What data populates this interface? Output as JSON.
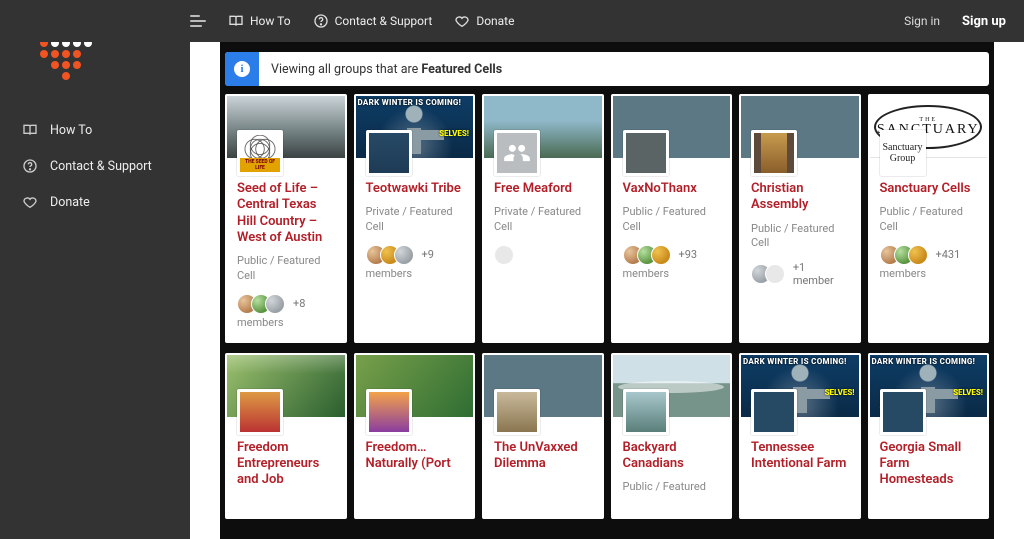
{
  "topnav": {
    "howto": "How To",
    "contact": "Contact & Support",
    "donate": "Donate",
    "signin": "Sign in",
    "signup": "Sign up"
  },
  "sidebar": {
    "howto": "How To",
    "contact": "Contact & Support",
    "donate": "Donate"
  },
  "notice": {
    "prefix": "Viewing all groups that are ",
    "emphasis": "Featured Cells"
  },
  "banner": {
    "darkwinter": "DARK WINTER IS COMING!",
    "selves": "SELVES!"
  },
  "sanctuary_oval": {
    "line1": "THE",
    "line2": "SANCTUARY"
  },
  "sanctuary_thumb": {
    "line1": "Sanctuary",
    "line2": "Group"
  },
  "labels": {
    "members": "members"
  },
  "cards_row1": [
    {
      "title": "Seed of Life – Central Texas Hill Country – West of Austin",
      "meta": "Public / Featured Cell",
      "plus": "+8"
    },
    {
      "title": "Teotwawki Tribe",
      "meta": "Private / Featured Cell",
      "plus": "+9"
    },
    {
      "title": "Free Meaford",
      "meta": "Private / Featured Cell",
      "plus": ""
    },
    {
      "title": "VaxNoThanx",
      "meta": "Public / Featured Cell",
      "plus": "+93"
    },
    {
      "title": "Christian Assembly",
      "meta": "Public / Featured Cell",
      "plus": "+1 member"
    },
    {
      "title": "Sanctuary Cells",
      "meta": "Public / Featured Cell",
      "plus": "+431"
    }
  ],
  "cards_row2": [
    {
      "title": "Freedom Entrepreneurs and Job",
      "meta": ""
    },
    {
      "title": "Freedom… Naturally (Port",
      "meta": ""
    },
    {
      "title": "The UnVaxxed Dilemma",
      "meta": ""
    },
    {
      "title": "Backyard Canadians",
      "meta": "Public / Featured"
    },
    {
      "title": "Tennessee Intentional Farm",
      "meta": ""
    },
    {
      "title": "Georgia Small Farm Homesteads",
      "meta": ""
    }
  ],
  "colors": {
    "brand_red": "#f05423",
    "title_red": "#b31f28",
    "info_blue": "#2b7de9"
  }
}
